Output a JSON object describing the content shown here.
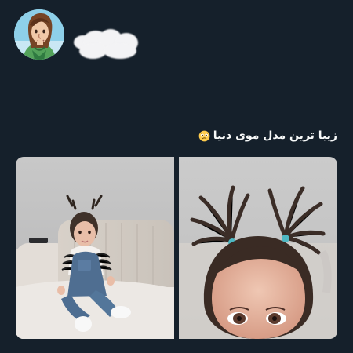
{
  "tweet": {
    "text": "زیبا ترین مدل موی دنیا",
    "emoji_icon": "pleading-face-icon"
  },
  "author": {
    "avatar_icon": "cartoon-avatar-icon",
    "username_redacted": true
  },
  "media": {
    "count": 2,
    "tiles": [
      {
        "name": "photo-left",
        "subject": "toddler-sitting-on-sofa"
      },
      {
        "name": "photo-right",
        "subject": "toddler-close-up-pigtails"
      }
    ]
  },
  "colors": {
    "background": "#15202b",
    "text": "#f7f9f9"
  }
}
